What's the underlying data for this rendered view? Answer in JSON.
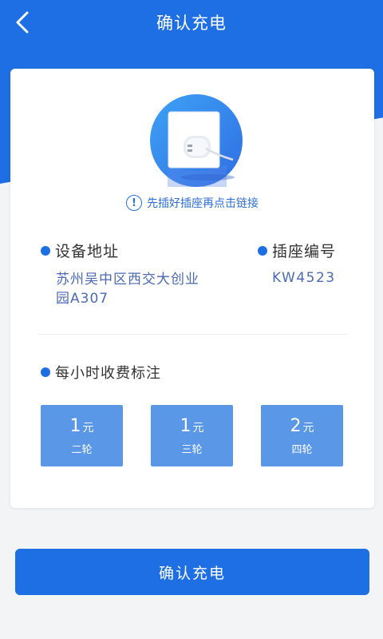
{
  "header": {
    "title": "确认充电",
    "back_icon": "chevron-left-icon"
  },
  "hint": {
    "icon": "info-icon",
    "text": "先插好插座再点击链接"
  },
  "device_address": {
    "label": "设备地址",
    "value": "苏州吴中区西交大创业园A307"
  },
  "socket_number": {
    "label": "插座编号",
    "value": "KW4523"
  },
  "pricing": {
    "label": "每小时收费标注",
    "items": [
      {
        "amount": "1",
        "unit": "元",
        "vehicle": "二轮"
      },
      {
        "amount": "1",
        "unit": "元",
        "vehicle": "三轮"
      },
      {
        "amount": "2",
        "unit": "元",
        "vehicle": "四轮"
      }
    ]
  },
  "confirm_button": {
    "label": "确认充电"
  },
  "colors": {
    "primary": "#1e6fe3",
    "price_box": "#5a97e6",
    "value_text": "#4b69b5",
    "background": "#f3f4f6"
  }
}
